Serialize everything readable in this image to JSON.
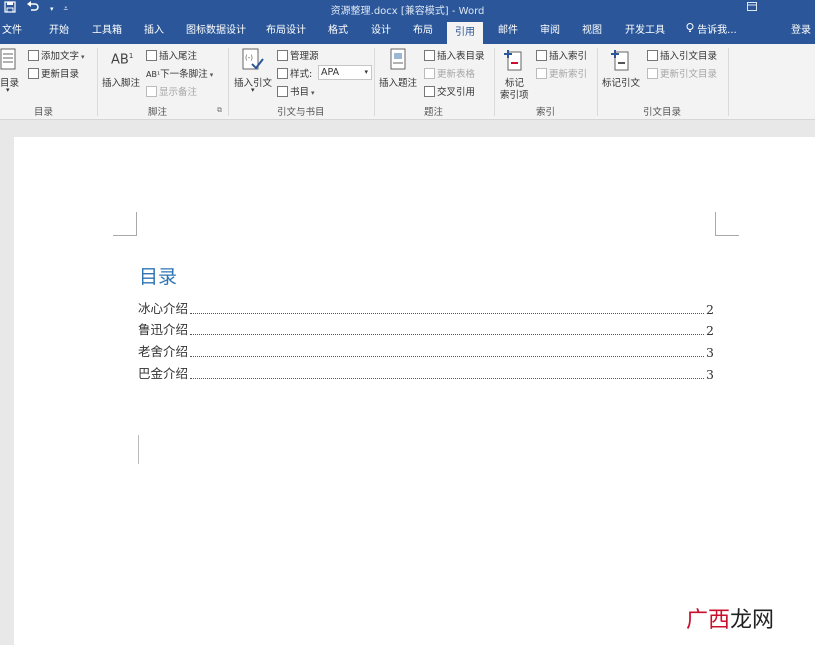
{
  "titlebar": {
    "title": "资源整理.docx [兼容模式] - Word",
    "save_icon": "save-icon",
    "undo_icon": "undo-icon"
  },
  "tabs": [
    {
      "label": "文件"
    },
    {
      "label": "开始"
    },
    {
      "label": "工具箱"
    },
    {
      "label": "插入"
    },
    {
      "label": "图标数据设计"
    },
    {
      "label": "布局设计"
    },
    {
      "label": "格式"
    },
    {
      "label": "设计"
    },
    {
      "label": "布局"
    },
    {
      "label": "引用"
    },
    {
      "label": "邮件"
    },
    {
      "label": "审阅"
    },
    {
      "label": "视图"
    },
    {
      "label": "开发工具"
    }
  ],
  "tellme": "告诉我...",
  "signin": "登录",
  "ribbon": {
    "toc_group": {
      "label": "目录",
      "toc_button": "目录",
      "add_text": "添加文字",
      "update_toc": "更新目录"
    },
    "footnote_group": {
      "label": "脚注",
      "insert_footnote": "插入脚注",
      "insert_endnote": "插入尾注",
      "next_footnote": "下一条脚注",
      "show_notes": "显示备注"
    },
    "citation_group": {
      "label": "引文与书目",
      "insert_citation": "插入引文",
      "manage_sources": "管理源",
      "style_label": "样式:",
      "style_value": "APA",
      "bibliography": "书目"
    },
    "caption_group": {
      "label": "题注",
      "insert_caption": "插入题注",
      "insert_table_of_figures": "插入表目录",
      "update_table": "更新表格",
      "cross_reference": "交叉引用"
    },
    "index_group": {
      "label": "索引",
      "mark_entry_line1": "标记",
      "mark_entry_line2": "索引项",
      "insert_index": "插入索引",
      "update_index": "更新索引"
    },
    "authorities_group": {
      "label": "引文目录",
      "mark_citation": "标记引文",
      "insert_toa": "插入引文目录",
      "update_toa": "更新引文目录"
    }
  },
  "document": {
    "toc_title": "目录",
    "entries": [
      {
        "text": "冰心介绍",
        "page": "2"
      },
      {
        "text": "鲁迅介绍",
        "page": "2"
      },
      {
        "text": "老舍介绍",
        "page": "3"
      },
      {
        "text": "巴金介绍",
        "page": "3"
      }
    ]
  },
  "watermark": {
    "part1": "广西",
    "part2": "龙网"
  }
}
